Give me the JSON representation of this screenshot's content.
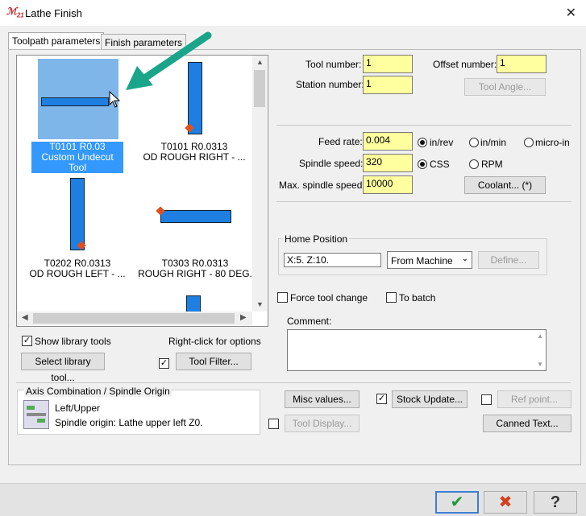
{
  "window": {
    "title": "Lathe Finish",
    "app_icon": "mastercam-icon",
    "close_glyph": "✕"
  },
  "tabs": [
    {
      "label": "Toolpath parameters"
    },
    {
      "label": "Finish parameters"
    }
  ],
  "tools": [
    {
      "line1": "T0101 R0.03",
      "line2": "Custom Undecut Tool",
      "selected": true
    },
    {
      "line1": "T0101 R0.0313",
      "line2": "OD ROUGH RIGHT - ..."
    },
    {
      "line1": "T0202 R0.0313",
      "line2": "OD ROUGH LEFT - ..."
    },
    {
      "line1": "T0303 R0.0313",
      "line2": "ROUGH RIGHT - 80 DEG."
    }
  ],
  "library": {
    "show_library_tools": "Show library tools",
    "right_click_hint": "Right-click for options",
    "select_library_tool": "Select library tool...",
    "tool_filter": "Tool Filter..."
  },
  "tool": {
    "tool_number_label": "Tool number:",
    "tool_number": "1",
    "offset_number_label": "Offset number:",
    "offset_number": "1",
    "station_number_label": "Station number:",
    "station_number": "1",
    "tool_angle": "Tool Angle..."
  },
  "feeds": {
    "feed_rate_label": "Feed rate:",
    "feed_rate": "0.004",
    "in_rev": "in/rev",
    "in_min": "in/min",
    "micro_in": "micro-in",
    "spindle_speed_label": "Spindle speed:",
    "spindle_speed": "320",
    "css": "CSS",
    "rpm": "RPM",
    "max_spindle_label": "Max. spindle speed:",
    "max_spindle": "10000",
    "coolant": "Coolant... (*)"
  },
  "home": {
    "group_label": "Home Position",
    "position": "X:5.  Z:10.",
    "mode": "From Machine",
    "define": "Define..."
  },
  "options": {
    "force_tool_change": "Force tool change",
    "to_batch": "To batch",
    "comment_label": "Comment:"
  },
  "axis": {
    "group_label": "Axis Combination / Spindle Origin",
    "combo": "Left/Upper",
    "origin": "Spindle origin: Lathe upper left   Z0."
  },
  "actions": {
    "misc_values": "Misc values...",
    "stock_update": "Stock Update...",
    "ref_point": "Ref point...",
    "tool_display": "Tool Display...",
    "canned_text": "Canned Text..."
  },
  "footer": {
    "ok": "✔",
    "cancel": "✖",
    "help": "?"
  },
  "colors": {
    "accent": "#3399ff",
    "tool_blue": "#1e7fe0",
    "annotation_arrow": "#1aa58a",
    "input_yellow": "#ffff9f"
  }
}
